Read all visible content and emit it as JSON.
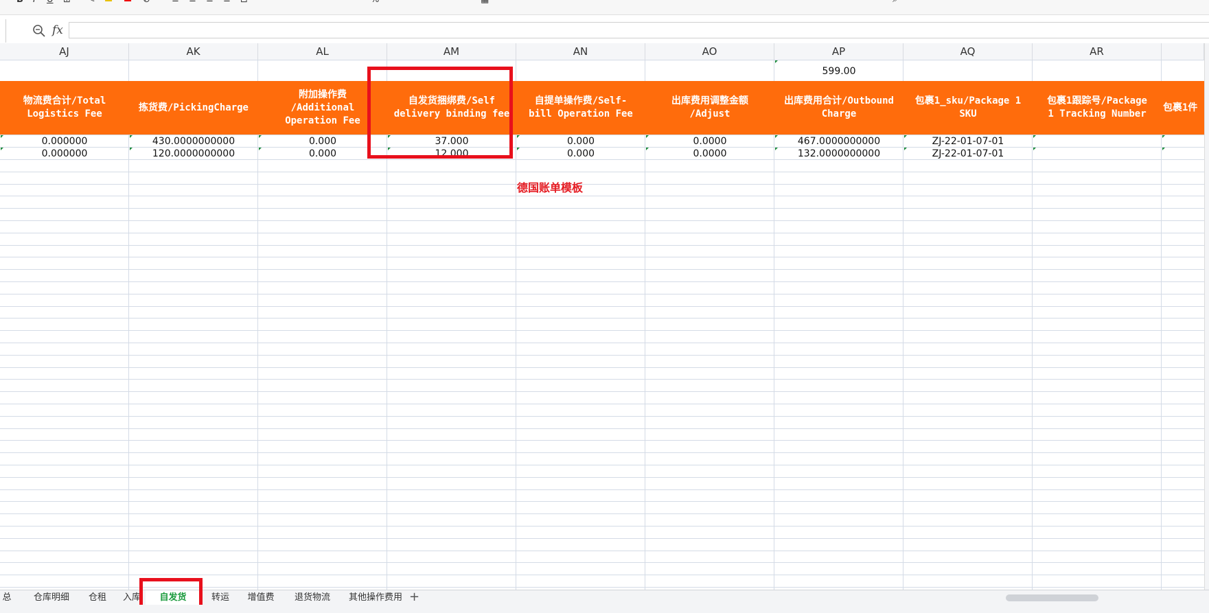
{
  "formula_bar": {
    "fx_label": "fx",
    "value": ""
  },
  "columns": [
    {
      "letter": "AJ",
      "header": [
        "物流费合计/Total",
        "Logistics Fee"
      ],
      "r1": "",
      "r2": "0.000000",
      "r3": "0.000000"
    },
    {
      "letter": "AK",
      "header": [
        "拣货费/PickingCharge"
      ],
      "r1": "",
      "r2": "430.0000000000",
      "r3": "120.0000000000"
    },
    {
      "letter": "AL",
      "header": [
        "附加操作费",
        "/Additional",
        "Operation Fee"
      ],
      "r1": "",
      "r2": "0.000",
      "r3": "0.000"
    },
    {
      "letter": "AM",
      "header": [
        "自发货捆绑费/Self",
        "delivery binding fee"
      ],
      "r1": "",
      "r2": "37.000",
      "r3": "12.000"
    },
    {
      "letter": "AN",
      "header": [
        "自提单操作费/Self-",
        "bill Operation Fee"
      ],
      "r1": "",
      "r2": "0.000",
      "r3": "0.000"
    },
    {
      "letter": "AO",
      "header": [
        "出库费用调整金额",
        "/Adjust"
      ],
      "r1": "",
      "r2": "0.0000",
      "r3": "0.0000"
    },
    {
      "letter": "AP",
      "header": [
        "出库费用合计/Outbound",
        "Charge"
      ],
      "r1": "599.00",
      "r2": "467.0000000000",
      "r3": "132.0000000000"
    },
    {
      "letter": "AQ",
      "header": [
        "包裹1_sku/Package 1",
        "SKU"
      ],
      "r1": "",
      "r2": "ZJ-22-01-07-01",
      "r3": "ZJ-22-01-07-01"
    },
    {
      "letter": "AR",
      "header": [
        "包裹1跟踪号/Package",
        "1 Tracking Number"
      ],
      "r1": "",
      "r2": "",
      "r3": ""
    },
    {
      "letter": "",
      "header": [
        "包裹1件"
      ],
      "r1": "",
      "r2": "",
      "r3": ""
    }
  ],
  "annotation": "德国账单模板",
  "sheet_tabs": [
    {
      "label": "总",
      "active": false
    },
    {
      "label": "仓库明细",
      "active": false
    },
    {
      "label": "仓租",
      "active": false
    },
    {
      "label": "入库",
      "active": false
    },
    {
      "label": "自发货",
      "active": true
    },
    {
      "label": "转运",
      "active": false
    },
    {
      "label": "增值费",
      "active": false
    },
    {
      "label": "退货物流",
      "active": false
    },
    {
      "label": "其他操作费用",
      "active": false
    }
  ],
  "colors": {
    "header_orange": "#ff6c0c",
    "highlight_red": "#e8101c",
    "active_tab_green": "#1c9b3e"
  }
}
